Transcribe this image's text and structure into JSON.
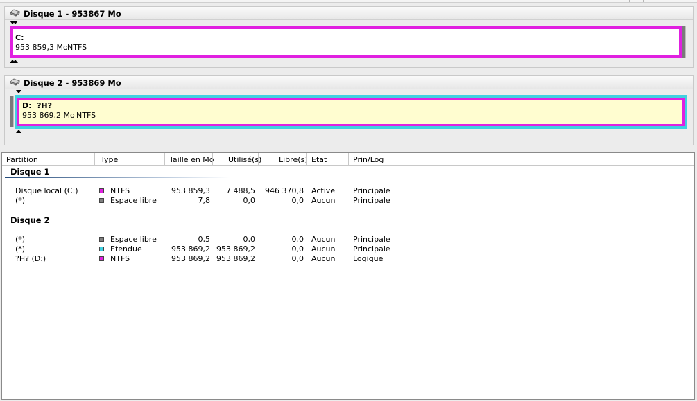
{
  "disks": [
    {
      "title": "Disque 1 - 953867 Mo",
      "partition": {
        "letter": "C:",
        "label": "",
        "size": "953 859,3 Mo",
        "fs": "NTFS",
        "border_color": "#e020e0",
        "fill_color": "#ffffff"
      }
    },
    {
      "title": "Disque 2 - 953869 Mo",
      "partition": {
        "letter": "D:",
        "label": "?H?",
        "size": "953 869,2 Mo",
        "fs": "NTFS",
        "border_color": "#e020e0",
        "outer_color": "#40d0e0",
        "fill_color": "#fffdd0"
      }
    }
  ],
  "table": {
    "columns": [
      "Partition",
      "Type",
      "Taille en Mo",
      "Utilisé(s)",
      "Libre(s)",
      "Etat",
      "Prin/Log"
    ],
    "groups": [
      {
        "title": "Disque 1",
        "rows": [
          {
            "partition": "Disque local (C:)",
            "type": "NTFS",
            "color": "#e020e0",
            "size": "953 859,3",
            "used": "7 488,5",
            "free": "946 370,8",
            "state": "Active",
            "primlog": "Principale"
          },
          {
            "partition": "(*)",
            "type": "Espace libre",
            "color": "#808080",
            "size": "7,8",
            "used": "0,0",
            "free": "0,0",
            "state": "Aucun",
            "primlog": "Principale"
          }
        ]
      },
      {
        "title": "Disque 2",
        "rows": [
          {
            "partition": "(*)",
            "type": "Espace libre",
            "color": "#808080",
            "size": "0,5",
            "used": "0,0",
            "free": "0,0",
            "state": "Aucun",
            "primlog": "Principale"
          },
          {
            "partition": "(*)",
            "type": "Etendue",
            "color": "#40d0e0",
            "size": "953 869,2",
            "used": "953 869,2",
            "free": "0,0",
            "state": "Aucun",
            "primlog": "Principale"
          },
          {
            "partition": "?H? (D:)",
            "type": "NTFS",
            "color": "#e020e0",
            "size": "953 869,2",
            "used": "953 869,2",
            "free": "0,0",
            "state": "Aucun",
            "primlog": "Logique"
          }
        ]
      }
    ]
  }
}
